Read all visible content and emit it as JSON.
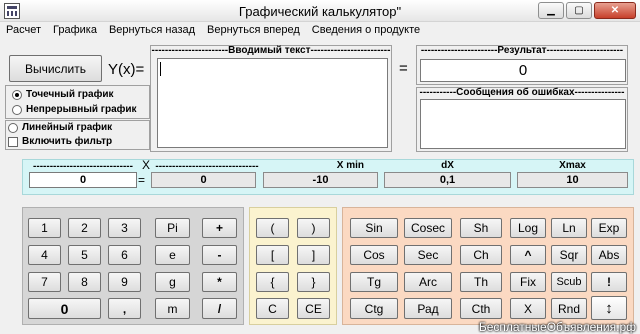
{
  "window": {
    "title": "Графический калькулятор\""
  },
  "menu": [
    "Расчет",
    "Графика",
    "Вернуться назад",
    "Вернуться вперед",
    "Сведения о продукте"
  ],
  "calc_button": "Вычислить",
  "yx_label": "Y(x)=",
  "input_title": "-----------------------Вводимый текст------------------------",
  "equals_sign": "=",
  "result_title": "-----------------------Результат-----------------------",
  "result_value": "0",
  "errors_title": "-----------Сообщения об ошибках---------------",
  "options": {
    "radio_point": "Точечный график",
    "radio_continuous": "Непрерывный график",
    "radio_linear": "Линейный график",
    "check_filter": "Включить фильтр"
  },
  "params": {
    "x_label": "X",
    "x_dashes": "------------------------------",
    "x_value": "0",
    "eq": "=",
    "xmin_dashes": "-------------------------------",
    "xmin_label": "X min",
    "xmin_value": "-10",
    "dx_label": "dX",
    "dx_value": "0,1",
    "xmax_label": "Xmax",
    "xmax_value": "10"
  },
  "keys": {
    "k1": "1",
    "k2": "2",
    "k3": "3",
    "kpi": "Pi",
    "kplus": "+",
    "k4": "4",
    "k5": "5",
    "k6": "6",
    "ke": "e",
    "kminus": "-",
    "k7": "7",
    "k8": "8",
    "k9": "9",
    "kg": "g",
    "kmul": "*",
    "k0": "0",
    "kcomma": ",",
    "km": "m",
    "kdiv": "/",
    "paren_l": "(",
    "paren_r": ")",
    "brack_l": "[",
    "brack_r": "]",
    "brace_l": "{",
    "brace_r": "}",
    "kc": "C",
    "kce": "CE",
    "sin": "Sin",
    "cosec": "Cosec",
    "sh": "Sh",
    "log": "Log",
    "ln": "Ln",
    "exp": "Exp",
    "cos": "Cos",
    "sec": "Sec",
    "ch": "Ch",
    "pow": "^",
    "sqr": "Sqr",
    "abs": "Abs",
    "tg": "Tg",
    "arc": "Arc",
    "th": "Th",
    "fix": "Fix",
    "scub": "Scub",
    "fact": "!",
    "ctg": "Ctg",
    "rad": "Рад",
    "cth": "Cth",
    "x": "X",
    "rnd": "Rnd",
    "arrows": "↕"
  },
  "watermark": "БесплатныеОбъявления.рф"
}
